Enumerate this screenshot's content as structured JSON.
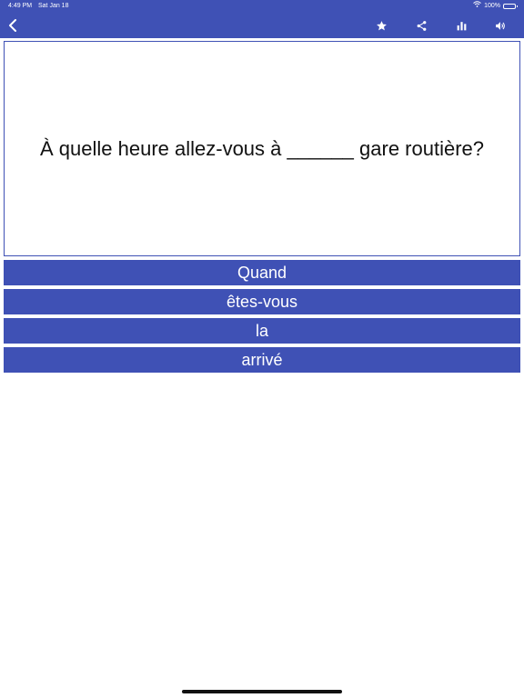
{
  "status_bar": {
    "time": "4:49 PM",
    "date": "Sat Jan 18",
    "battery": "100%",
    "icons": [
      "wifi-icon",
      "battery-icon"
    ]
  },
  "toolbar": {
    "icons": [
      "back-chevron-icon",
      "star-icon",
      "share-icon",
      "bar-chart-icon",
      "speaker-icon"
    ]
  },
  "question": {
    "text": "À quelle heure allez-vous à ______ gare routière?"
  },
  "answers": [
    {
      "label": "Quand"
    },
    {
      "label": "êtes-vous"
    },
    {
      "label": "la"
    },
    {
      "label": "arrivé"
    }
  ],
  "colors": {
    "primary": "#3f51b5",
    "background": "#ffffff",
    "text": "#111111"
  }
}
